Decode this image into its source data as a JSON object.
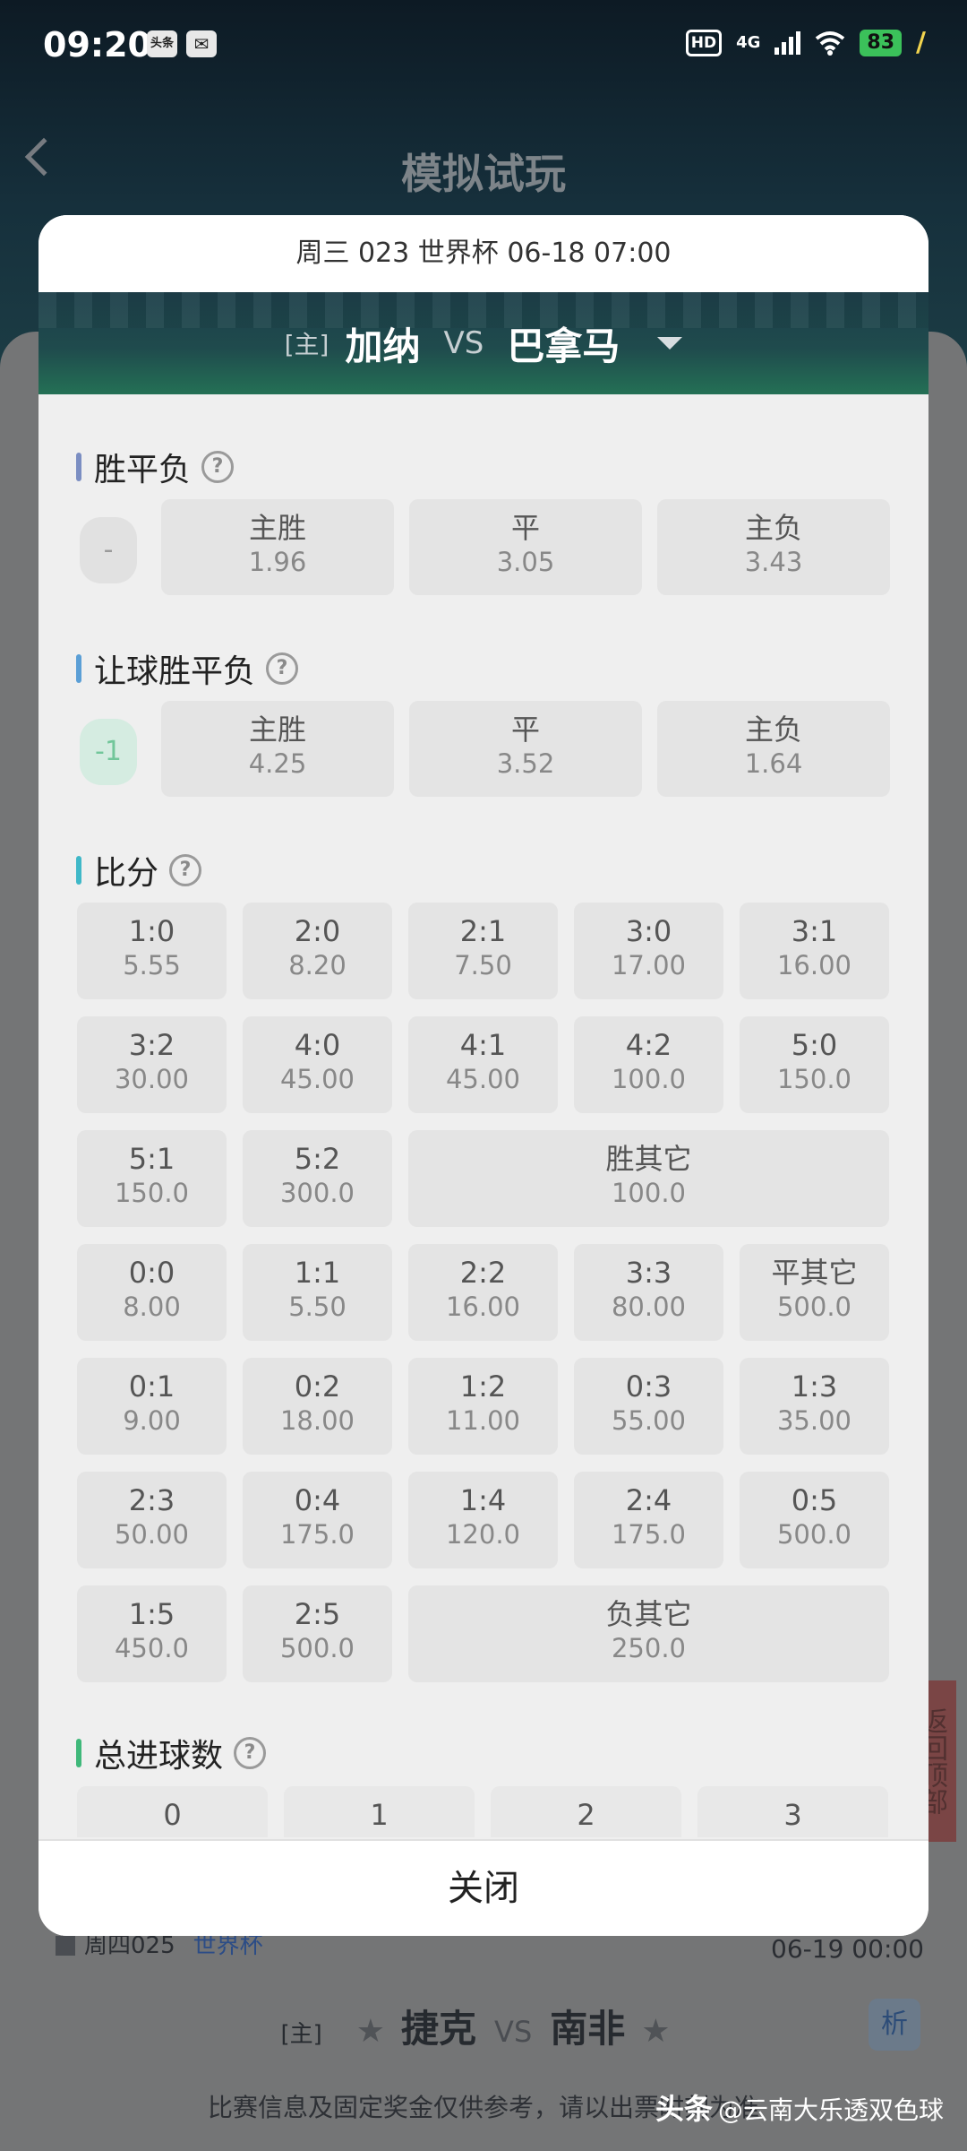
{
  "status": {
    "time": "09:20",
    "notif1": "头条",
    "hd": "HD",
    "network": "4G",
    "battery": "83"
  },
  "background": {
    "title": "模拟试玩",
    "match": {
      "weekday_no": "周四025",
      "league": "世界杯",
      "date": "06-19 00:00",
      "home_tag": "[主]",
      "home": "捷克",
      "vs": "VS",
      "away": "南非",
      "analysis": "析"
    },
    "note": "比赛信息及固定奖金仅供参考，请以出票时刻为准",
    "side_button": "返回顶部"
  },
  "watermark": {
    "app": "头条",
    "author": "@云南大乐透双色球"
  },
  "modal": {
    "header": "周三 023 世界杯 06-18 07:00",
    "home_tag": "[主]",
    "home": "加纳",
    "vs": "VS",
    "away": "巴拿马",
    "close": "关闭",
    "sections": {
      "wdl": {
        "title": "胜平负",
        "handicap": "-",
        "options": [
          {
            "label": "主胜",
            "odd": "1.96"
          },
          {
            "label": "平",
            "odd": "3.05"
          },
          {
            "label": "主负",
            "odd": "3.43"
          }
        ]
      },
      "hwdl": {
        "title": "让球胜平负",
        "handicap": "-1",
        "options": [
          {
            "label": "主胜",
            "odd": "4.25"
          },
          {
            "label": "平",
            "odd": "3.52"
          },
          {
            "label": "主负",
            "odd": "1.64"
          }
        ]
      },
      "score": {
        "title": "比分",
        "cells": [
          {
            "label": "1:0",
            "odd": "5.55"
          },
          {
            "label": "2:0",
            "odd": "8.20"
          },
          {
            "label": "2:1",
            "odd": "7.50"
          },
          {
            "label": "3:0",
            "odd": "17.00"
          },
          {
            "label": "3:1",
            "odd": "16.00"
          },
          {
            "label": "3:2",
            "odd": "30.00"
          },
          {
            "label": "4:0",
            "odd": "45.00"
          },
          {
            "label": "4:1",
            "odd": "45.00"
          },
          {
            "label": "4:2",
            "odd": "100.0"
          },
          {
            "label": "5:0",
            "odd": "150.0"
          },
          {
            "label": "5:1",
            "odd": "150.0"
          },
          {
            "label": "5:2",
            "odd": "300.0"
          },
          {
            "label": "胜其它",
            "odd": "100.0"
          },
          {
            "label": "0:0",
            "odd": "8.00"
          },
          {
            "label": "1:1",
            "odd": "5.50"
          },
          {
            "label": "2:2",
            "odd": "16.00"
          },
          {
            "label": "3:3",
            "odd": "80.00"
          },
          {
            "label": "平其它",
            "odd": "500.0"
          },
          {
            "label": "0:1",
            "odd": "9.00"
          },
          {
            "label": "0:2",
            "odd": "18.00"
          },
          {
            "label": "1:2",
            "odd": "11.00"
          },
          {
            "label": "0:3",
            "odd": "55.00"
          },
          {
            "label": "1:3",
            "odd": "35.00"
          },
          {
            "label": "2:3",
            "odd": "50.00"
          },
          {
            "label": "0:4",
            "odd": "175.0"
          },
          {
            "label": "1:4",
            "odd": "120.0"
          },
          {
            "label": "2:4",
            "odd": "175.0"
          },
          {
            "label": "0:5",
            "odd": "500.0"
          },
          {
            "label": "1:5",
            "odd": "450.0"
          },
          {
            "label": "2:5",
            "odd": "500.0"
          },
          {
            "label": "负其它",
            "odd": "250.0"
          }
        ]
      },
      "total_goals": {
        "title": "总进球数",
        "options": [
          "0",
          "1",
          "2",
          "3"
        ]
      }
    }
  },
  "colors": {
    "bar_wdl": "#7b8ec2",
    "bar_hwdl": "#5b9fd6",
    "bar_score": "#3fb8c8",
    "bar_total": "#3fb87a"
  }
}
